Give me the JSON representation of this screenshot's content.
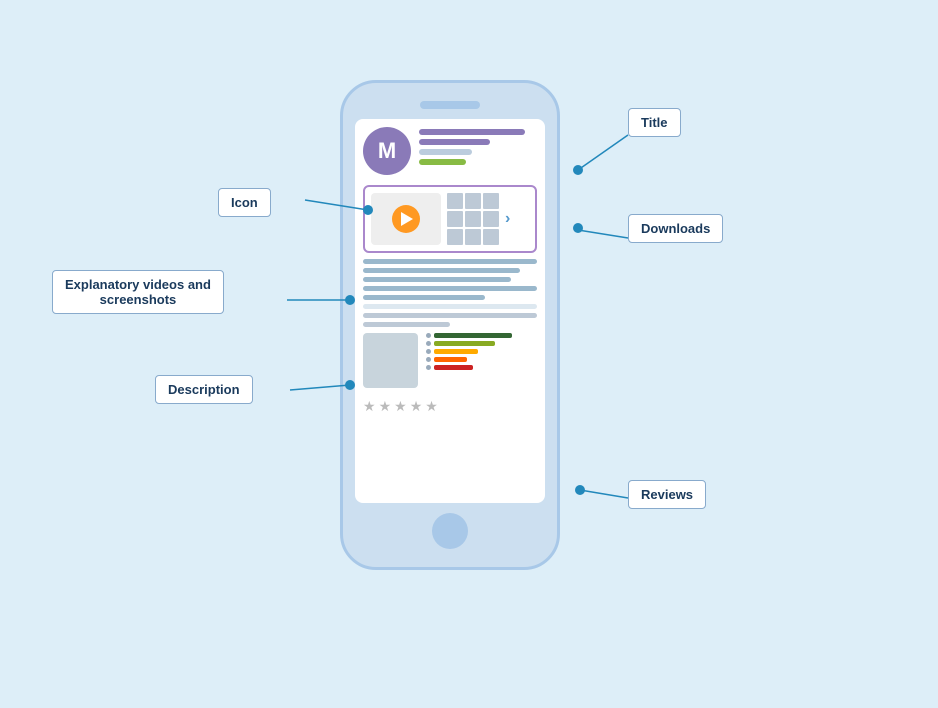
{
  "labels": {
    "title": "Title",
    "icon": "Icon",
    "downloads": "Downloads",
    "explanatory": "Explanatory videos and\nscreenshots",
    "description": "Description",
    "reviews": "Reviews"
  },
  "phone": {
    "app_icon_letter": "M"
  },
  "rating_bars": [
    {
      "color": "#336633",
      "width": "70%"
    },
    {
      "color": "#88aa22",
      "width": "55%"
    },
    {
      "color": "#ffaa00",
      "width": "40%"
    },
    {
      "color": "#ff6600",
      "width": "25%"
    },
    {
      "color": "#cc2222",
      "width": "35%"
    }
  ]
}
